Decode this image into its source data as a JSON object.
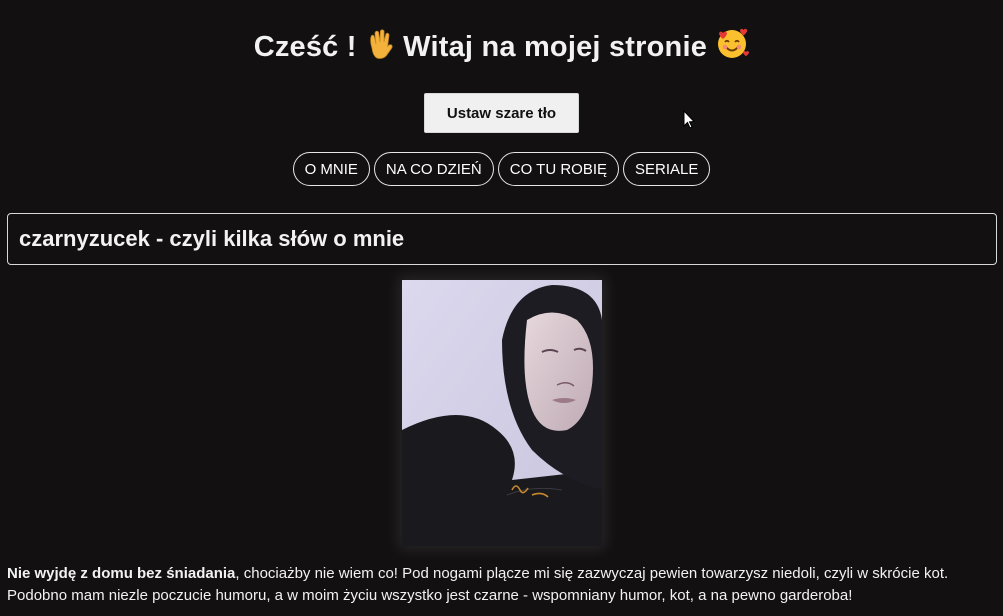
{
  "header": {
    "greeting_before": "Cześć !",
    "greeting_after": "Witaj na mojej stronie",
    "wave_icon": "waving-hand-icon",
    "love_icon": "smiling-face-with-hearts-icon"
  },
  "toolbar": {
    "gray_bg_label": "Ustaw szare tło"
  },
  "nav": {
    "items": [
      {
        "label": "O MNIE"
      },
      {
        "label": "NA CO DZIEŃ"
      },
      {
        "label": "CO TU ROBIĘ"
      },
      {
        "label": "SERIALE"
      }
    ]
  },
  "section": {
    "title": "czarnyzucek - czyli kilka słów o mnie"
  },
  "bio": {
    "bold_lead": "Nie wyjdę z domu bez śniadania",
    "text": ", chociażby nie wiem co! Pod nogami plącze mi się zazwyczaj pewien towarzysz niedoli, czyli w skrócie kot. Podobno mam niezle poczucie humoru, a w moim życiu wszystko jest czarne - wspomniany humor, kot, a na pewno garderoba!"
  },
  "colors": {
    "background": "#121010",
    "text": "#ffffff",
    "button_bg": "#f0f0f0",
    "border": "#e6e6e6"
  }
}
